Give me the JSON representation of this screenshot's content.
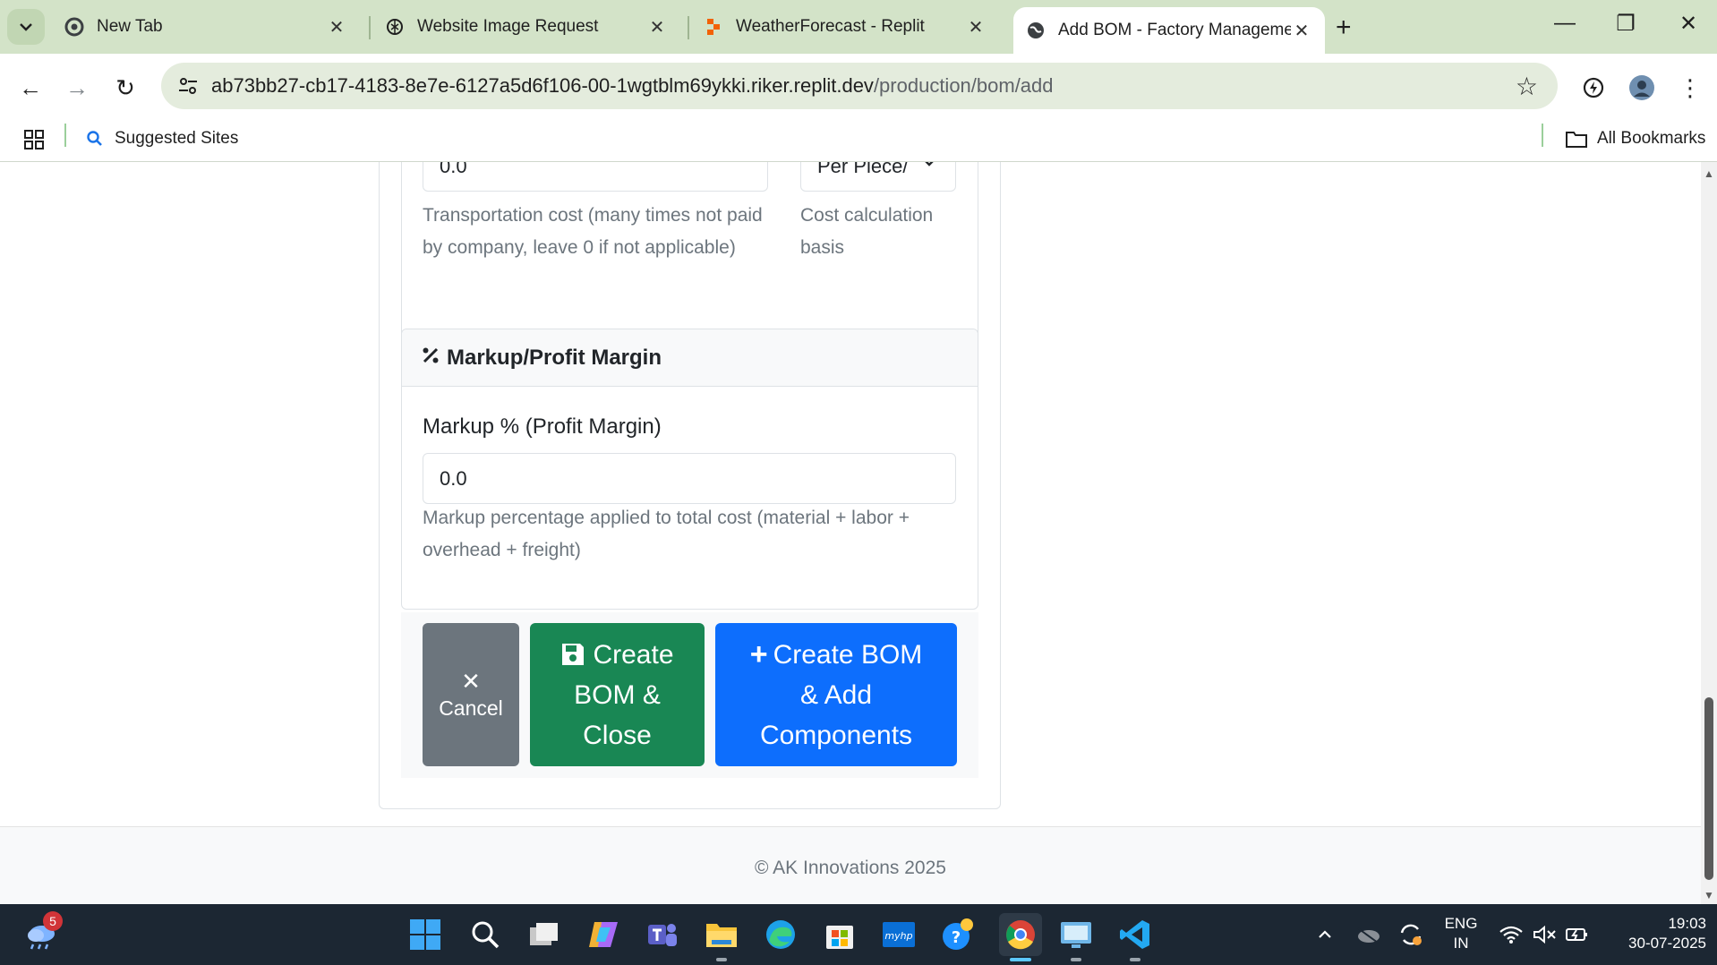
{
  "browser": {
    "tabs": [
      {
        "title": "New Tab",
        "icon": "chrome-icon"
      },
      {
        "title": "Website Image Request",
        "icon": "openai-icon"
      },
      {
        "title": "WeatherForecast - Replit",
        "icon": "replit-icon"
      },
      {
        "title": "Add BOM - Factory Managemen",
        "icon": "globe-icon"
      }
    ],
    "url_host": "ab73bb27-cb17-4183-8e7e-6127a5d6f106-00-1wgtblm69ykki.riker.replit.dev",
    "url_path": "/production/bom/add",
    "bookmarks": {
      "suggested": "Suggested Sites",
      "all": "All Bookmarks"
    }
  },
  "form": {
    "freight": {
      "value": "0.0",
      "help": [
        "Transportation cost (many times not paid",
        "by company, leave 0 if not applicable)"
      ],
      "basis_value": "Per Piece/",
      "basis_help": [
        "Cost calculation",
        "basis"
      ]
    },
    "markup": {
      "header": "Markup/Profit Margin",
      "label": "Markup % (Profit Margin)",
      "value": "0.0",
      "help": [
        "Markup percentage applied to total cost (material + labor +",
        "overhead + freight)"
      ]
    },
    "buttons": {
      "cancel": "Cancel",
      "create_close": [
        "Create",
        "BOM &",
        "Close"
      ],
      "create_add": [
        "Create BOM",
        "& Add",
        "Components"
      ]
    }
  },
  "footer": {
    "text": "© AK Innovations 2025"
  },
  "taskbar": {
    "weather_badge": "5",
    "lang": [
      "ENG",
      "IN"
    ],
    "time": "19:03",
    "date": "30-07-2025"
  },
  "colors": {
    "tabbar": "#d3e3c8",
    "omnibox": "#e4ecdd",
    "secondary": "#6c757d",
    "success": "#198754",
    "primary": "#0d6efd",
    "taskbar": "#1c2733"
  }
}
